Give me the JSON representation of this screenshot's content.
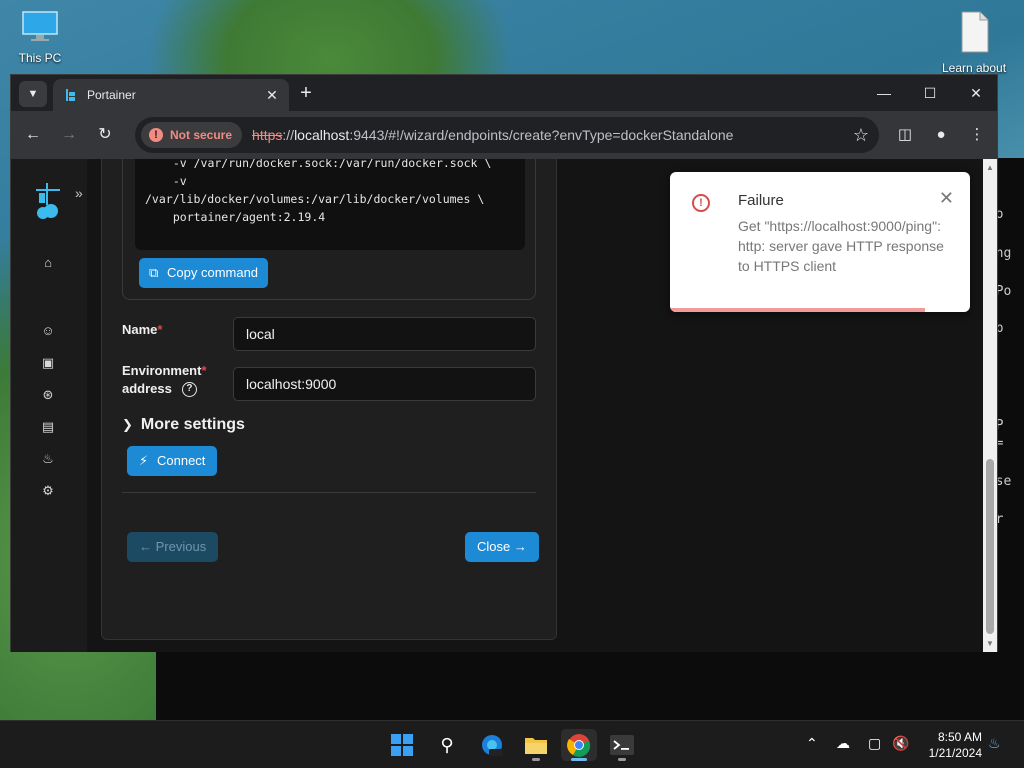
{
  "desktop": {
    "icon_this_pc": "This PC",
    "icon_learn": "Learn about"
  },
  "terminal": {
    "lines": [
      "tio",
      "ding",
      "g Po",
      "l p",
      "g P",
      "on=",
      "s se",
      "ser"
    ]
  },
  "browser": {
    "tab_title": "Portainer",
    "url_scheme": "https",
    "url_host": "localhost",
    "url_rest": ":9443/#!/wizard/endpoints/create?envType=dockerStandalone",
    "security_label": "Not secure"
  },
  "form": {
    "command_lines": [
      "  -v /var/run/docker.sock:/var/run/docker.sock \\",
      "  -v",
      "/var/lib/docker/volumes:/var/lib/docker/volumes \\",
      "  portainer/agent:2.19.4"
    ],
    "copy_label": "Copy command",
    "name_label": "Name",
    "name_value": "local",
    "address_label_1": "Environment",
    "address_label_2": "address",
    "address_value": "localhost:9000",
    "more_settings": "More settings",
    "connect_label": "Connect",
    "previous_label": "Previous",
    "close_label": "Close"
  },
  "toast": {
    "title": "Failure",
    "message": "Get \"https://localhost:9000/ping\": http: server gave HTTP response to HTTPS client",
    "progress": 0.85
  },
  "taskbar": {
    "time": "8:50 AM",
    "date": "1/21/2024"
  },
  "colors": {
    "accent": "#1c8ad4",
    "danger": "#d94b4b"
  }
}
